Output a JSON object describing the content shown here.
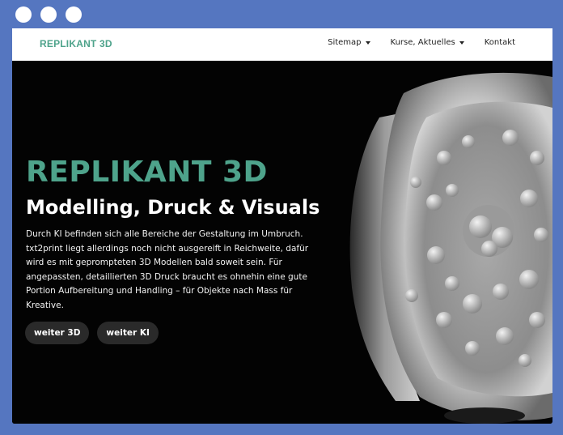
{
  "window": {
    "controls": [
      "close",
      "minimize",
      "maximize"
    ]
  },
  "nav": {
    "brand": "REPLIKANT 3D",
    "items": [
      {
        "label": "Sitemap",
        "dropdown": true
      },
      {
        "label": "Kurse, Aktuelles",
        "dropdown": true
      },
      {
        "label": "Kontakt",
        "dropdown": false
      }
    ]
  },
  "hero": {
    "title": "REPLIKANT 3D",
    "subtitle": "Modelling, Druck & Visuals",
    "text": "Durch KI befinden sich alle Bereiche der Gestaltung im Umbruch. txt2print liegt allerdings noch nicht ausgereift in Reichweite, dafür wird es mit geprompteten 3D Modellen bald soweit sein. Für angepassten, detaillierten 3D Druck braucht es ohnehin eine gute Portion Aufbereitung und Handling – für Objekte nach Mass für Kreative.",
    "buttons": [
      {
        "label": "weiter 3D"
      },
      {
        "label": "weiter KI"
      }
    ]
  },
  "colors": {
    "frame": "#5576c0",
    "accent": "#4ea38b",
    "hero_bg": "#030303",
    "button_bg": "#2a2a2a"
  }
}
